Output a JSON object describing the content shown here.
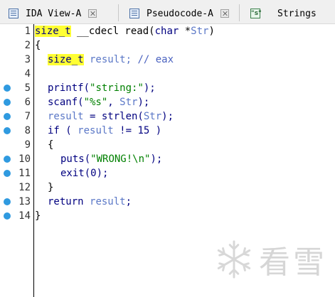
{
  "tabs": [
    {
      "label": "IDA View-A",
      "icon": "ida-view-icon",
      "closable": true
    },
    {
      "label": "Pseudocode-A",
      "icon": "pseudocode-icon",
      "closable": true
    },
    {
      "label": "Strings",
      "icon": "strings-icon",
      "icon_glyph": "\"s\"",
      "closable": false
    }
  ],
  "code_lines": [
    {
      "num": "1",
      "bp": false
    },
    {
      "num": "2",
      "bp": false
    },
    {
      "num": "3",
      "bp": false
    },
    {
      "num": "4",
      "bp": false
    },
    {
      "num": "5",
      "bp": true
    },
    {
      "num": "6",
      "bp": true
    },
    {
      "num": "7",
      "bp": true
    },
    {
      "num": "8",
      "bp": true
    },
    {
      "num": "9",
      "bp": false
    },
    {
      "num": "10",
      "bp": true
    },
    {
      "num": "11",
      "bp": true
    },
    {
      "num": "12",
      "bp": false
    },
    {
      "num": "13",
      "bp": true
    },
    {
      "num": "14",
      "bp": true
    }
  ],
  "code": {
    "l1_type": "size_t",
    "l1_rest1": " __cdecl read(",
    "l1_char": "char",
    "l1_rest2": " *",
    "l1_str": "Str",
    "l1_close": ")",
    "l2": "{",
    "l3_type": "size_t",
    "l3_var": " result; ",
    "l3_comment": "// eax",
    "l5_func": "printf(",
    "l5_str": "\"string:\"",
    "l5_end": ");",
    "l6_func": "scanf(",
    "l6_str": "\"%s\"",
    "l6_mid": ", ",
    "l6_var": "Str",
    "l6_end": ");",
    "l7_var": "result",
    "l7_mid": " = strlen(",
    "l7_arg": "Str",
    "l7_end": ");",
    "l8_kw": "if ( ",
    "l8_var": "result",
    "l8_end": " != 15 )",
    "l9": "{",
    "l10_func": "puts(",
    "l10_str": "\"WRONG!\\n\"",
    "l10_end": ");",
    "l11": "exit(0);",
    "l12": "}",
    "l13_kw": "return ",
    "l13_var": "result",
    "l13_end": ";",
    "l14": "}"
  },
  "watermark": {
    "text": "看雪",
    "icon": "snowflake-logo-icon"
  },
  "colors": {
    "highlight": "#ffff33",
    "breakpoint_dot": "#2f9ae0",
    "keyword": "#000080",
    "string_literal": "#008000",
    "variable": "#5b78c7"
  }
}
